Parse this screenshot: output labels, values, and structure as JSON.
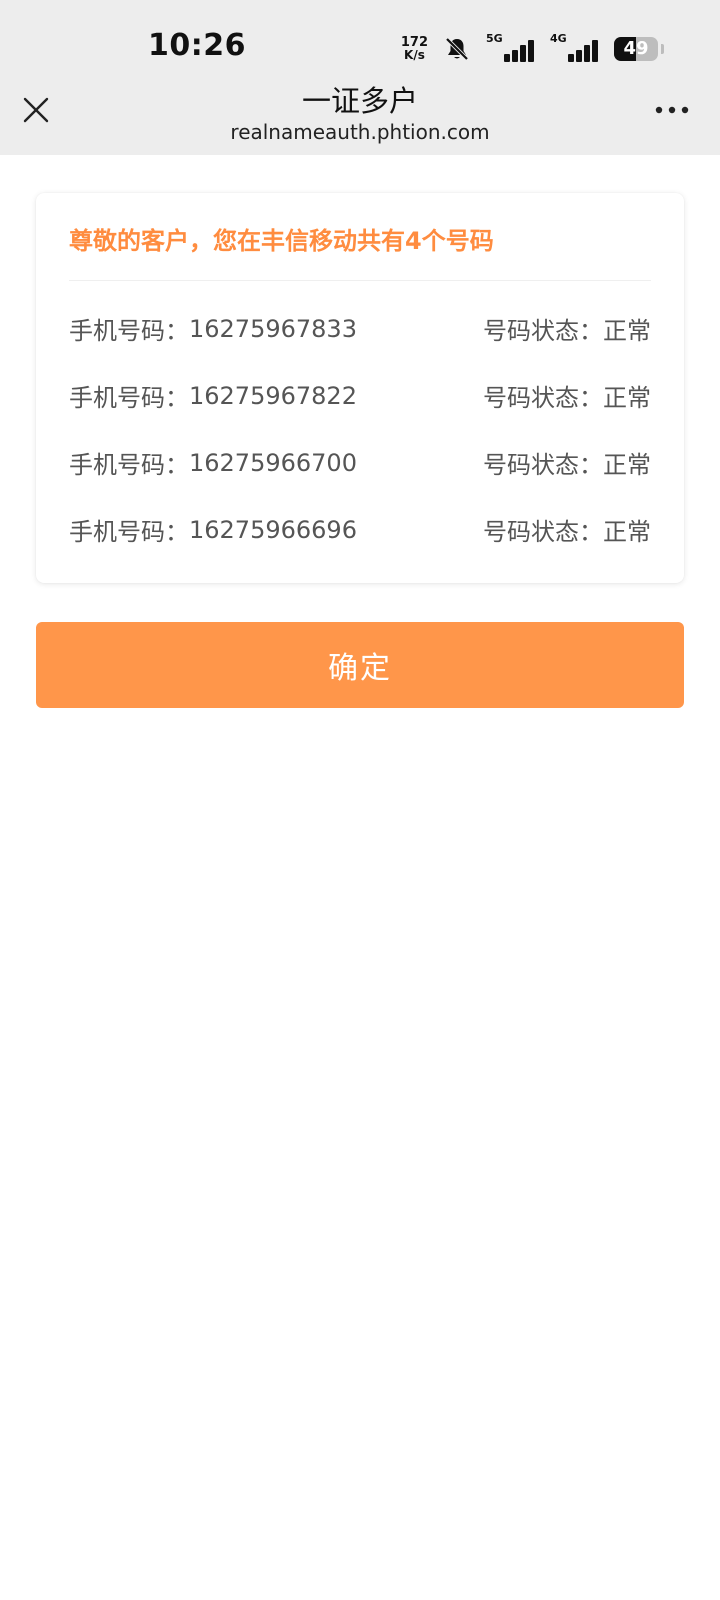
{
  "status_bar": {
    "time": "10:26",
    "net_speed_value": "172",
    "net_speed_unit": "K/s",
    "signal_1_tech": "5G",
    "signal_2_tech": "4G",
    "battery_level": "49"
  },
  "title_bar": {
    "title": "一证多户",
    "url": "realnameauth.phtion.com",
    "close_icon": "close-icon",
    "more_icon": "more-icon"
  },
  "card": {
    "title": "尊敬的客户，您在丰信移动共有4个号码",
    "phone_label": "手机号码：",
    "status_label": "号码状态：",
    "rows": [
      {
        "phone": "16275967833",
        "status": "正常"
      },
      {
        "phone": "16275967822",
        "status": "正常"
      },
      {
        "phone": "16275966700",
        "status": "正常"
      },
      {
        "phone": "16275966696",
        "status": "正常"
      }
    ]
  },
  "confirm_button": {
    "label": "确定"
  },
  "colors": {
    "accent": "#ff8c3f",
    "button": "#ff964a",
    "topbar_bg": "#ededed",
    "text_gray": "#555555"
  }
}
